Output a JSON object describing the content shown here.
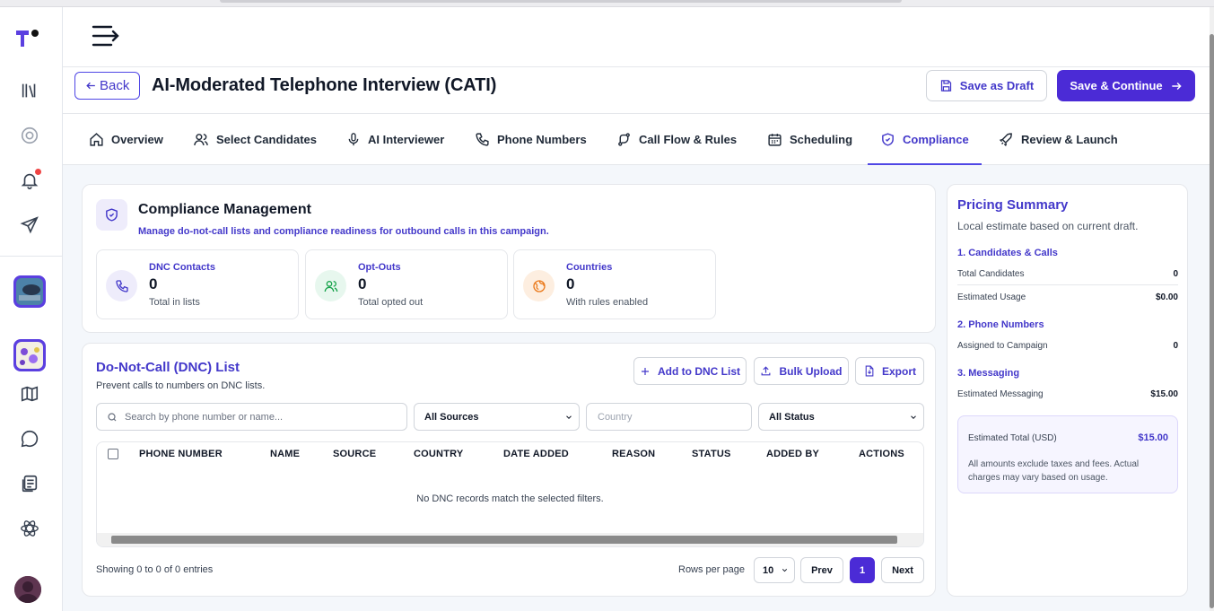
{
  "header": {
    "back_label": "Back",
    "title": "AI-Moderated Telephone Interview (CATI)",
    "save_draft_label": "Save as Draft",
    "save_continue_label": "Save & Continue"
  },
  "tabs": [
    {
      "label": "Overview",
      "icon": "home-icon"
    },
    {
      "label": "Select Candidates",
      "icon": "users-icon"
    },
    {
      "label": "AI Interviewer",
      "icon": "microphone-icon"
    },
    {
      "label": "Phone Numbers",
      "icon": "phone-icon"
    },
    {
      "label": "Call Flow & Rules",
      "icon": "branch-icon"
    },
    {
      "label": "Scheduling",
      "icon": "calendar-icon"
    },
    {
      "label": "Compliance",
      "icon": "shield-icon",
      "active": true
    },
    {
      "label": "Review & Launch",
      "icon": "rocket-icon"
    }
  ],
  "compliance": {
    "title": "Compliance Management",
    "subtitle": "Manage do-not-call lists and compliance readiness for outbound calls in this campaign.",
    "stats": [
      {
        "label": "DNC Contacts",
        "value": "0",
        "caption": "Total in lists"
      },
      {
        "label": "Opt-Outs",
        "value": "0",
        "caption": "Total opted out"
      },
      {
        "label": "Countries",
        "value": "0",
        "caption": "With rules enabled"
      }
    ]
  },
  "dnc": {
    "title": "Do-Not-Call (DNC) List",
    "subtitle": "Prevent calls to numbers on DNC lists.",
    "add_label": "Add to DNC List",
    "bulk_label": "Bulk Upload",
    "export_label": "Export",
    "search_placeholder": "Search by phone number or name...",
    "source_filter": "All Sources",
    "country_placeholder": "Country",
    "status_filter": "All Status",
    "columns": [
      "PHONE NUMBER",
      "NAME",
      "SOURCE",
      "COUNTRY",
      "DATE ADDED",
      "REASON",
      "STATUS",
      "ADDED BY",
      "ACTIONS"
    ],
    "empty_message": "No DNC records match the selected filters.",
    "showing": "Showing 0 to 0 of 0 entries",
    "rows_per_page_label": "Rows per page",
    "rows_per_page": "10",
    "prev_label": "Prev",
    "current_page": "1",
    "next_label": "Next"
  },
  "pricing": {
    "title": "Pricing Summary",
    "subtitle": "Local estimate based on current draft.",
    "sections": [
      {
        "heading": "1. Candidates & Calls",
        "rows": [
          {
            "label": "Total Candidates",
            "value": "0"
          },
          {
            "label": "Estimated Usage",
            "value": "$0.00"
          }
        ]
      },
      {
        "heading": "2. Phone Numbers",
        "rows": [
          {
            "label": "Assigned to Campaign",
            "value": "0"
          }
        ]
      },
      {
        "heading": "3. Messaging",
        "rows": [
          {
            "label": "Estimated Messaging",
            "value": "$15.00"
          }
        ]
      }
    ],
    "total_label": "Estimated Total (USD)",
    "total_value": "$15.00",
    "note": "All amounts exclude taxes and fees. Actual charges may vary based on usage."
  },
  "colors": {
    "accent": "#4b2bd6",
    "accent_text": "#4338ca",
    "notification": "#ef4444"
  }
}
